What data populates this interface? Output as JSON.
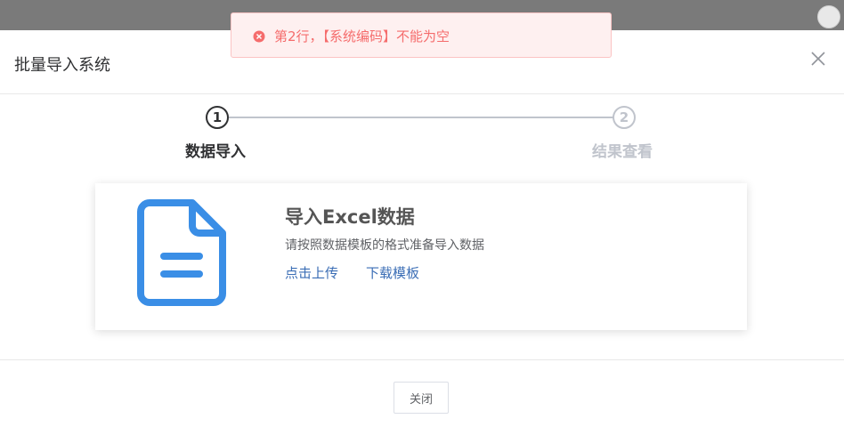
{
  "dialog": {
    "title": "批量导入系统"
  },
  "steps": [
    {
      "number": "1",
      "label": "数据导入",
      "state": "active"
    },
    {
      "number": "2",
      "label": "结果查看",
      "state": "inactive"
    }
  ],
  "card": {
    "title": "导入Excel数据",
    "description": "请按照数据模板的格式准备导入数据",
    "upload_link": "点击上传",
    "download_link": "下载模板",
    "icon": "document-icon"
  },
  "footer": {
    "close_label": "关闭"
  },
  "toast": {
    "message": "第2行，【系统编码】不能为空",
    "icon": "error-circle-icon"
  },
  "colors": {
    "accent_blue": "#3a8ee6",
    "link_blue": "#3a6db5",
    "error_red": "#f56c6c",
    "error_bg": "#fef0f0"
  }
}
